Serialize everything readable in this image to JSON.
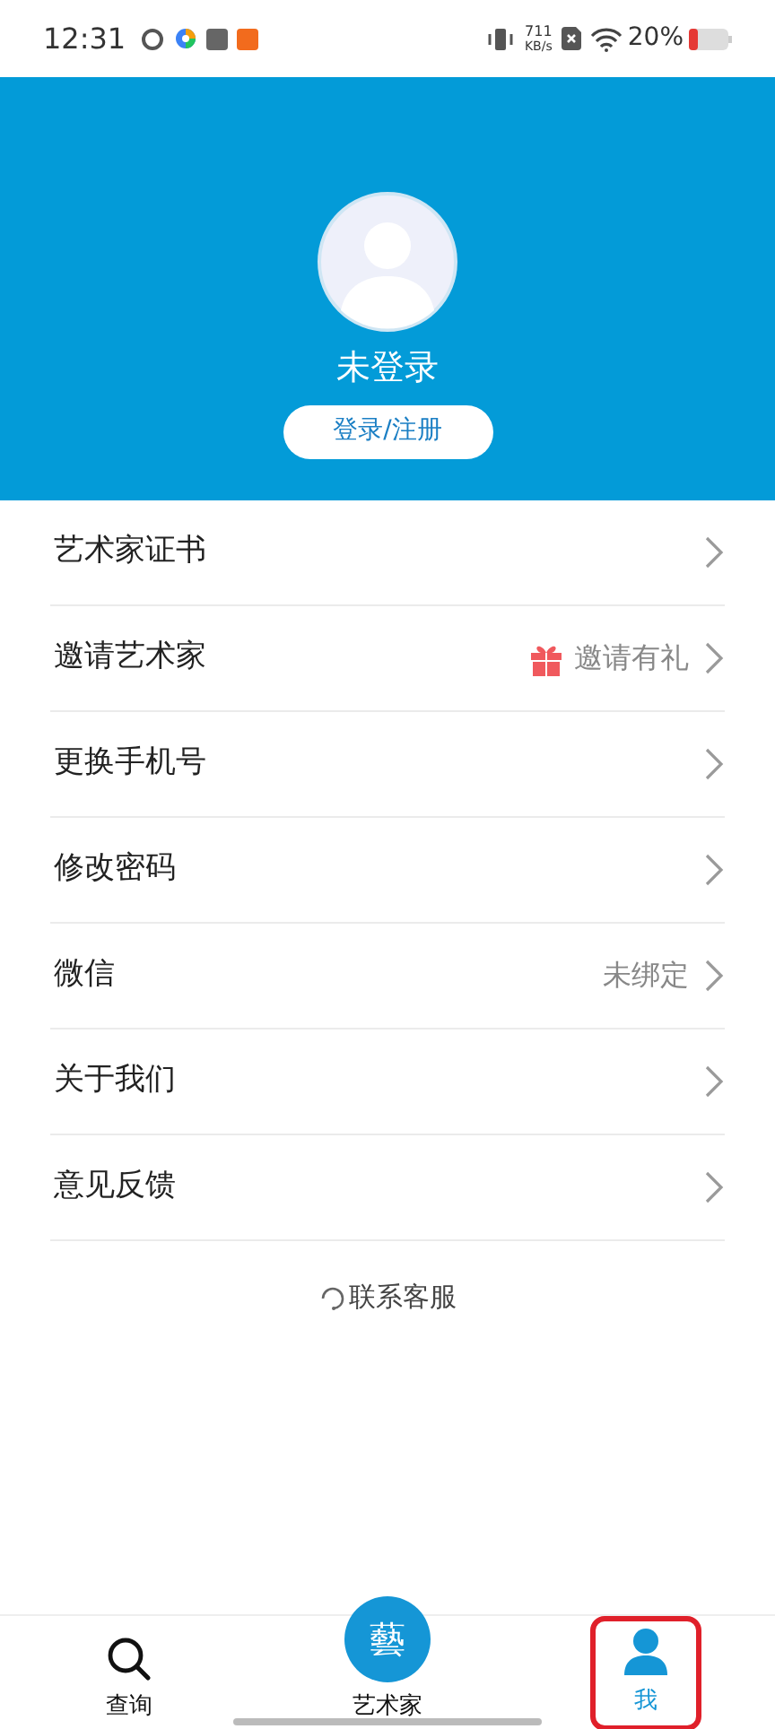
{
  "status_bar": {
    "time": "12:31",
    "speed_value": "711",
    "speed_unit": "KB/s",
    "battery": "20%"
  },
  "profile": {
    "name": "未登录",
    "login_button": "登录/注册"
  },
  "menu": [
    {
      "label": "艺术家证书",
      "kind": "plain"
    },
    {
      "label": "邀请艺术家",
      "kind": "gift",
      "value": "邀请有礼"
    },
    {
      "label": "更换手机号",
      "kind": "plain"
    },
    {
      "label": "修改密码",
      "kind": "plain"
    },
    {
      "label": "微信",
      "kind": "plain",
      "value": "未绑定"
    },
    {
      "label": "关于我们",
      "kind": "plain"
    },
    {
      "label": "意见反馈",
      "kind": "plain"
    }
  ],
  "contact": "联系客服",
  "tab_bar": [
    {
      "label": "查询",
      "kind": "search",
      "selected": false,
      "highlighted": false
    },
    {
      "label": "艺术家",
      "kind": "logo",
      "logo": "藝",
      "selected": false,
      "highlighted": false
    },
    {
      "label": "我",
      "kind": "person",
      "selected": true,
      "highlighted": true
    }
  ]
}
